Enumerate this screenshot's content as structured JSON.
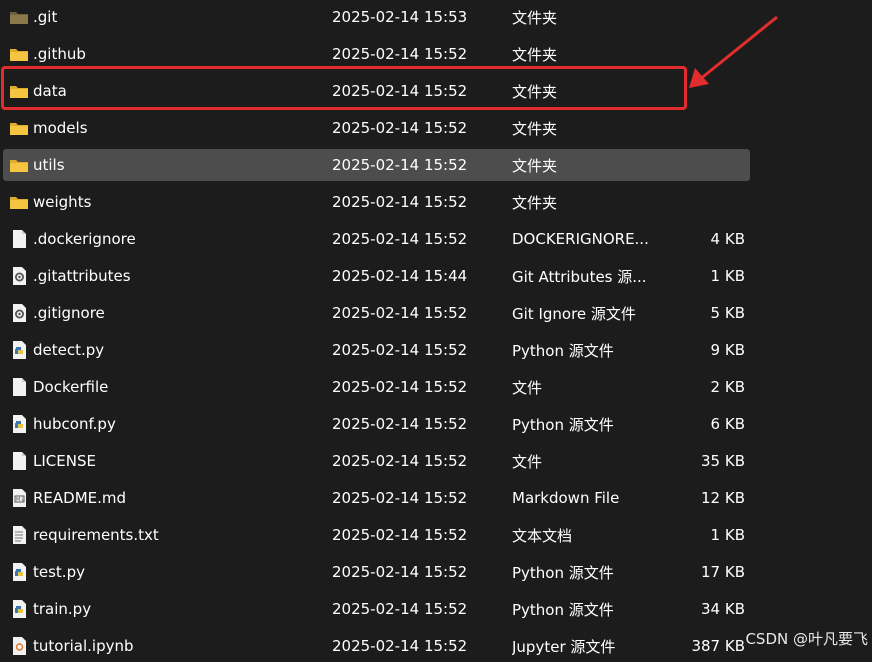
{
  "files": [
    {
      "name": ".git",
      "date": "2025-02-14 15:53",
      "type": "文件夹",
      "size": "",
      "icon": "folder-dim-icon"
    },
    {
      "name": ".github",
      "date": "2025-02-14 15:52",
      "type": "文件夹",
      "size": "",
      "icon": "folder-icon"
    },
    {
      "name": "data",
      "date": "2025-02-14 15:52",
      "type": "文件夹",
      "size": "",
      "icon": "folder-icon"
    },
    {
      "name": "models",
      "date": "2025-02-14 15:52",
      "type": "文件夹",
      "size": "",
      "icon": "folder-icon"
    },
    {
      "name": "utils",
      "date": "2025-02-14 15:52",
      "type": "文件夹",
      "size": "",
      "icon": "folder-icon"
    },
    {
      "name": "weights",
      "date": "2025-02-14 15:52",
      "type": "文件夹",
      "size": "",
      "icon": "folder-icon"
    },
    {
      "name": ".dockerignore",
      "date": "2025-02-14 15:52",
      "type": "DOCKERIGNORE...",
      "size": "4 KB",
      "icon": "file-icon"
    },
    {
      "name": ".gitattributes",
      "date": "2025-02-14 15:44",
      "type": "Git Attributes 源...",
      "size": "1 KB",
      "icon": "gear-file-icon"
    },
    {
      "name": ".gitignore",
      "date": "2025-02-14 15:52",
      "type": "Git Ignore 源文件",
      "size": "5 KB",
      "icon": "gear-file-icon"
    },
    {
      "name": "detect.py",
      "date": "2025-02-14 15:52",
      "type": "Python 源文件",
      "size": "9 KB",
      "icon": "python-file-icon"
    },
    {
      "name": "Dockerfile",
      "date": "2025-02-14 15:52",
      "type": "文件",
      "size": "2 KB",
      "icon": "file-icon"
    },
    {
      "name": "hubconf.py",
      "date": "2025-02-14 15:52",
      "type": "Python 源文件",
      "size": "6 KB",
      "icon": "python-file-icon"
    },
    {
      "name": "LICENSE",
      "date": "2025-02-14 15:52",
      "type": "文件",
      "size": "35 KB",
      "icon": "file-icon"
    },
    {
      "name": "README.md",
      "date": "2025-02-14 15:52",
      "type": "Markdown File",
      "size": "12 KB",
      "icon": "markdown-file-icon"
    },
    {
      "name": "requirements.txt",
      "date": "2025-02-14 15:52",
      "type": "文本文档",
      "size": "1 KB",
      "icon": "text-file-icon"
    },
    {
      "name": "test.py",
      "date": "2025-02-14 15:52",
      "type": "Python 源文件",
      "size": "17 KB",
      "icon": "python-file-icon"
    },
    {
      "name": "train.py",
      "date": "2025-02-14 15:52",
      "type": "Python 源文件",
      "size": "34 KB",
      "icon": "python-file-icon"
    },
    {
      "name": "tutorial.ipynb",
      "date": "2025-02-14 15:52",
      "type": "Jupyter 源文件",
      "size": "387 KB",
      "icon": "notebook-file-icon"
    }
  ],
  "selected_row": "utils",
  "highlighted_row": "data",
  "watermark": "CSDN @叶凡要飞",
  "colors": {
    "background": "#1c1c1c",
    "selected": "#4d4d4d",
    "highlight": "#e12d2d",
    "folder": "#f5c542",
    "folder_dim": "#8a7a4a"
  }
}
